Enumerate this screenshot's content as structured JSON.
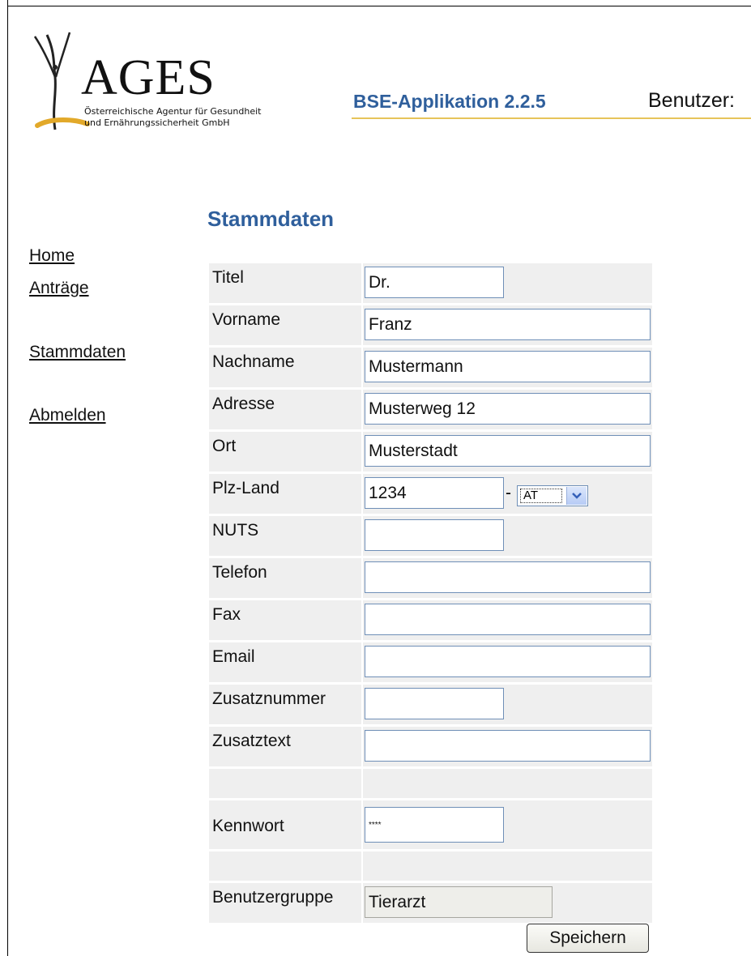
{
  "header": {
    "logo": {
      "name": "AGES",
      "subtitle_line1": "Österreichische Agentur für Gesundheit",
      "subtitle_line2": "und Ernährungssicherheit GmbH"
    },
    "app_title": "BSE-Applikation 2.2.5",
    "user_label": "Benutzer:",
    "accent_color": "#e7c45a",
    "title_color": "#2f5f9c"
  },
  "nav": {
    "items": [
      {
        "label": "Home"
      },
      {
        "label": "Anträge"
      },
      {
        "label": "Stammdaten"
      },
      {
        "label": "Abmelden"
      }
    ]
  },
  "page": {
    "title": "Stammdaten"
  },
  "form": {
    "titel": {
      "label": "Titel",
      "value": "Dr."
    },
    "vorname": {
      "label": "Vorname",
      "value": "Franz"
    },
    "nachname": {
      "label": "Nachname",
      "value": "Mustermann"
    },
    "adresse": {
      "label": "Adresse",
      "value": "Musterweg 12"
    },
    "ort": {
      "label": "Ort",
      "value": "Musterstadt"
    },
    "plz_land": {
      "label": "Plz-Land",
      "plz": "1234",
      "separator": "-",
      "land": "AT"
    },
    "nuts": {
      "label": "NUTS",
      "value": ""
    },
    "telefon": {
      "label": "Telefon",
      "value": ""
    },
    "fax": {
      "label": "Fax",
      "value": ""
    },
    "email": {
      "label": "Email",
      "value": ""
    },
    "zusatznummer": {
      "label": "Zusatznummer",
      "value": ""
    },
    "zusatztext": {
      "label": "Zusatztext",
      "value": ""
    },
    "kennwort": {
      "label": "Kennwort",
      "value": "****"
    },
    "benutzergruppe": {
      "label": "Benutzergruppe",
      "value": "Tierarzt"
    },
    "save_label": "Speichern"
  }
}
